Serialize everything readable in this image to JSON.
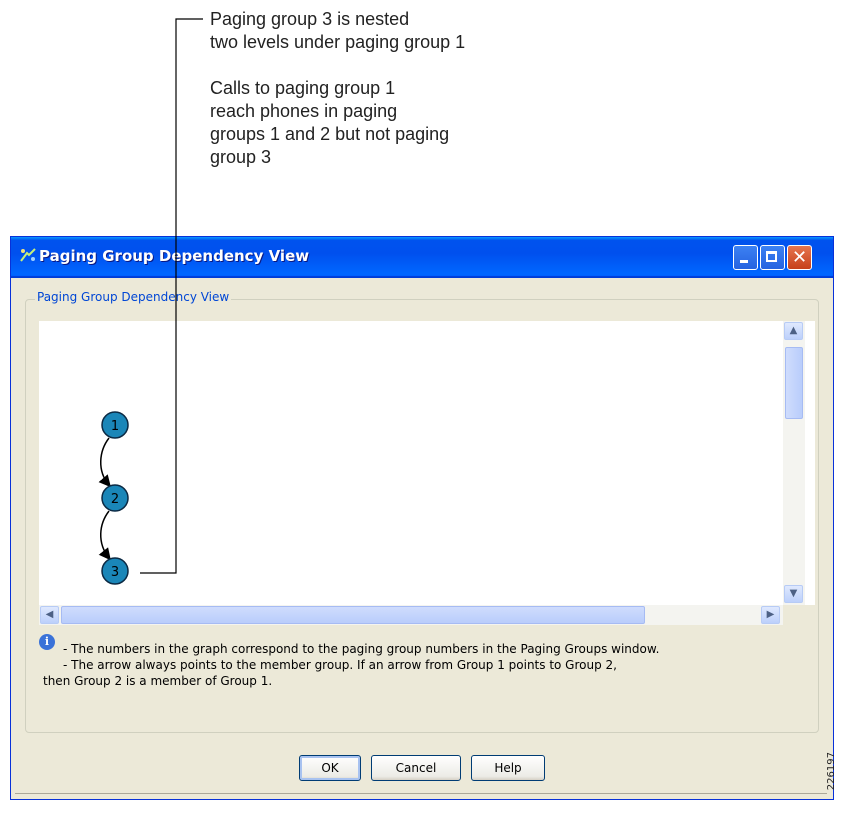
{
  "annotation": {
    "callout_lines_1": [
      "Paging group 3 is nested",
      "two levels under paging group 1"
    ],
    "callout_lines_2": [
      "Calls to paging group 1",
      "reach phones in paging",
      "groups 1 and 2 but not paging",
      "group 3"
    ]
  },
  "window": {
    "title": "Paging Group Dependency View",
    "group_legend": "Paging Group Dependency View"
  },
  "graph": {
    "nodes": [
      "1",
      "2",
      "3"
    ]
  },
  "note": {
    "lines": [
      "- The numbers in the graph correspond to the paging group numbers in the Paging Groups window.",
      "- The arrow always points to the member group. If an arrow from Group 1 points to Group 2,",
      "then Group 2 is a member of Group 1."
    ]
  },
  "buttons": {
    "ok": "OK",
    "cancel": "Cancel",
    "help": "Help"
  },
  "figure_id": "226197",
  "colors": {
    "node_fill": "#1a86b8",
    "title_bar": "#0055ea",
    "legend_text": "#0046d5"
  }
}
